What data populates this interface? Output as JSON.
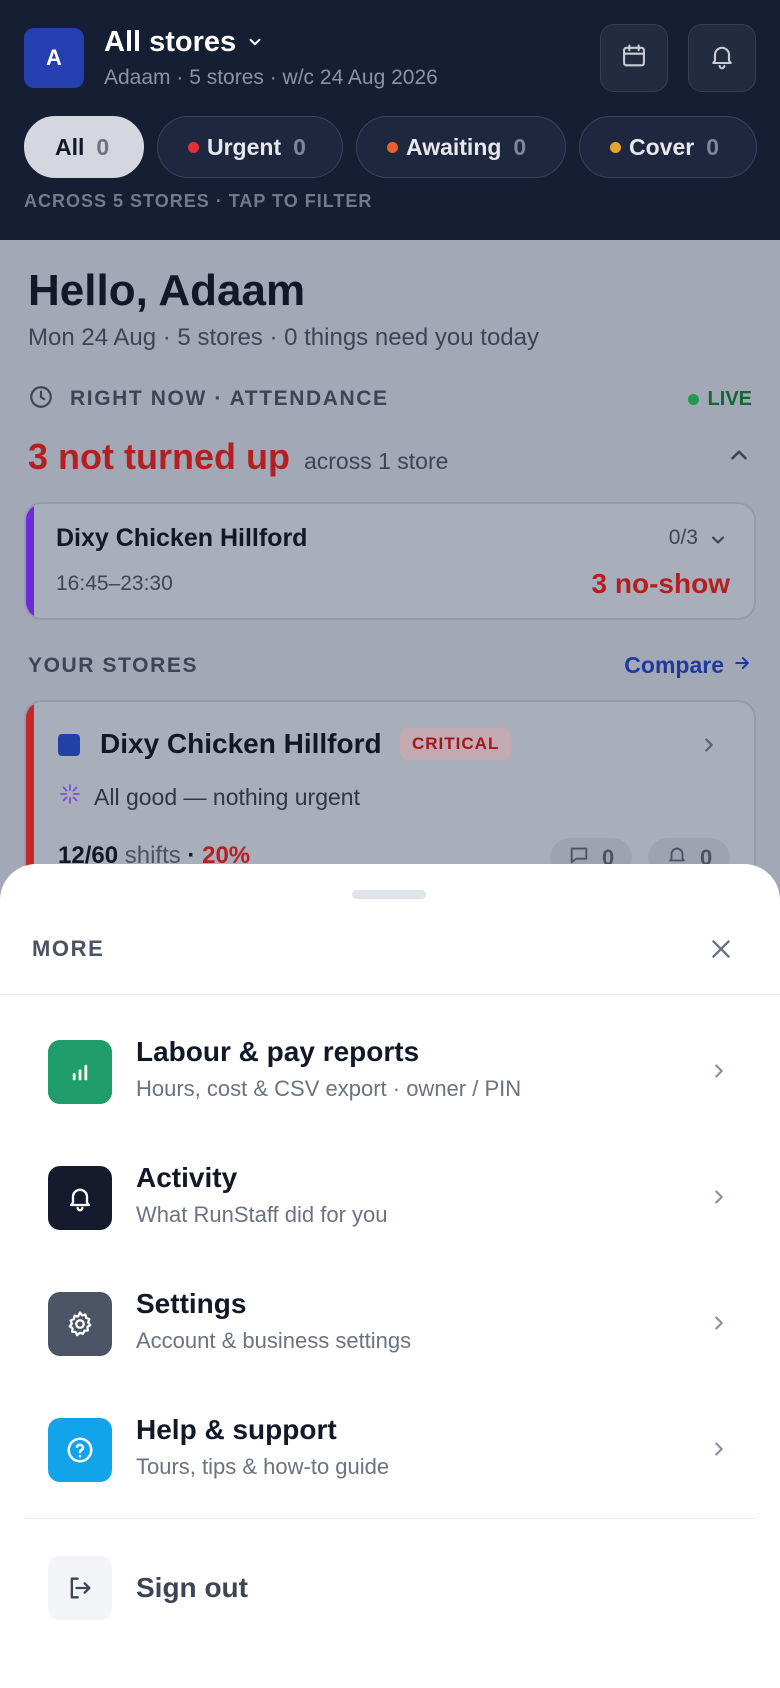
{
  "header": {
    "avatar_letter": "A",
    "title": "All stores",
    "subtitle": "Adaam · 5 stores · w/c 24 Aug 2026",
    "filters": [
      {
        "label": "All",
        "count": "0"
      },
      {
        "label": "Urgent",
        "count": "0",
        "dot_color": "#e0303a"
      },
      {
        "label": "Awaiting",
        "count": "0",
        "dot_color": "#e8612c"
      },
      {
        "label": "Cover",
        "count": "0",
        "dot_color": "#e8a32c"
      }
    ],
    "filter_note": "ACROSS 5 STORES · TAP TO FILTER"
  },
  "greeting": {
    "title": "Hello, Adaam",
    "subtitle": "Mon 24 Aug · 5 stores · 0 things need you today"
  },
  "attendance": {
    "section_label": "RIGHT NOW · ATTENDANCE",
    "live_label": "LIVE",
    "headline": "3 not turned up",
    "headline_sub": "across 1 store",
    "card": {
      "store": "Dixy Chicken Hillford",
      "time": "16:45–23:30",
      "ratio": "0/3",
      "noshow": "3 no-show"
    }
  },
  "stores": {
    "section_label": "YOUR STORES",
    "compare_label": "Compare",
    "card": {
      "name": "Dixy Chicken Hillford",
      "badge": "CRITICAL",
      "status": "All good — nothing urgent",
      "shifts": "12/60",
      "shifts_word": "shifts",
      "separator": "·",
      "pct": "20%",
      "messages_count": "0",
      "alerts_count": "0"
    }
  },
  "sheet": {
    "title": "MORE",
    "items": [
      {
        "label": "Labour & pay reports",
        "sub": "Hours, cost & CSV export · owner / PIN",
        "icon": "bar-chart-icon",
        "color": "#1f9d6a"
      },
      {
        "label": "Activity",
        "sub": "What RunStaff did for you",
        "icon": "bell-icon",
        "color": "#141b2d"
      },
      {
        "label": "Settings",
        "sub": "Account & business settings",
        "icon": "gear-icon",
        "color": "#4b5565"
      },
      {
        "label": "Help & support",
        "sub": "Tours, tips & how-to guide",
        "icon": "question-icon",
        "color": "#12a4ea"
      }
    ],
    "signout_label": "Sign out"
  }
}
